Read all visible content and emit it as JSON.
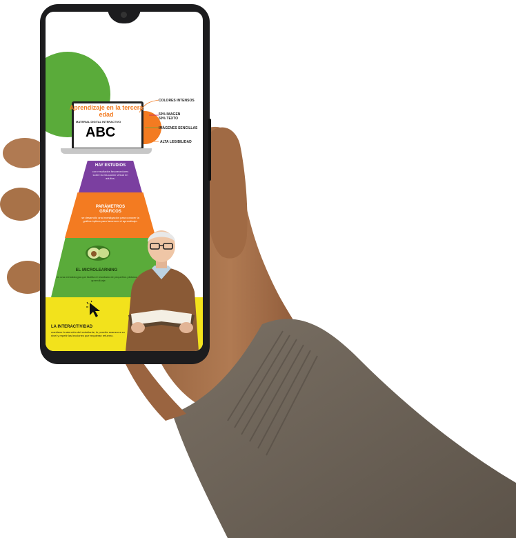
{
  "infographic": {
    "title": "Aprendizaje en la tercera edad",
    "subtitle": "MATERIAL DIGITAL INTERACTIVO",
    "screen_text": "ABC",
    "annotations": [
      "COLORES INTENSOS",
      "50% IMAGEN",
      "50% TEXTO",
      "IMÁGENES SENCILLAS",
      "ALTA LEGIBILIDAD"
    ],
    "levels": [
      {
        "title": "HAY ESTUDIOS",
        "body": "con resultados favorecedores sobre la educación virtual en adultos.",
        "color": "#7b3fa0"
      },
      {
        "title": "PARÁMETROS GRÁFICOS",
        "body": "se desarrolló una investigación para conocer la gráfica óptima para favorecer el aprendizaje.",
        "color": "#f37b21"
      },
      {
        "title": "EL MICROLEARNING",
        "body": "es una metodología que facilita el resultado de pequeños pildoras de aprendizaje.",
        "color": "#5aab3a"
      },
      {
        "title": "LA INTERACTIVIDAD",
        "body": "mantiene la atención del estudiante, le permite avanzar a su nivel y repetir las lecciones que requieran refuerzo.",
        "color": "#f2e21c"
      }
    ]
  },
  "colors": {
    "green": "#5aab3a",
    "orange": "#f37b21",
    "purple": "#7b3fa0",
    "yellow": "#f2e21c",
    "sweater": "#6c6256",
    "skin": "#a9744d"
  }
}
